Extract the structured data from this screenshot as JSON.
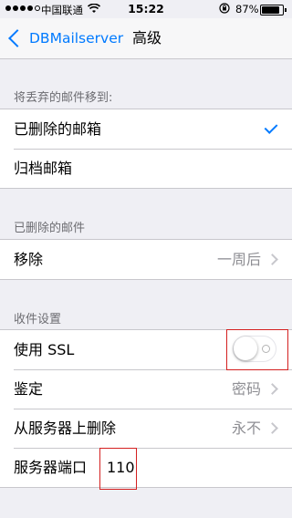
{
  "status_bar": {
    "carrier": "中国联通",
    "time": "15:22",
    "battery": "87%"
  },
  "nav": {
    "back_label": "DBMailserver",
    "title": "高级"
  },
  "sections": {
    "move_discarded": {
      "header": "将丢弃的邮件移到:",
      "rows": [
        {
          "label": "已删除的邮箱",
          "checked": true
        },
        {
          "label": "归档邮箱",
          "checked": false
        }
      ]
    },
    "deleted_mail": {
      "header": "已删除的邮件",
      "remove_label": "移除",
      "remove_value": "一周后"
    },
    "incoming": {
      "header": "收件设置",
      "ssl_label": "使用 SSL",
      "ssl_enabled": false,
      "auth_label": "鉴定",
      "auth_value": "密码",
      "delete_label": "从服务器上删除",
      "delete_value": "永不",
      "port_label": "服务器端口",
      "port_value": "110"
    }
  },
  "colors": {
    "accent": "#007aff",
    "highlight": "#d42020",
    "background": "#efeff4"
  }
}
